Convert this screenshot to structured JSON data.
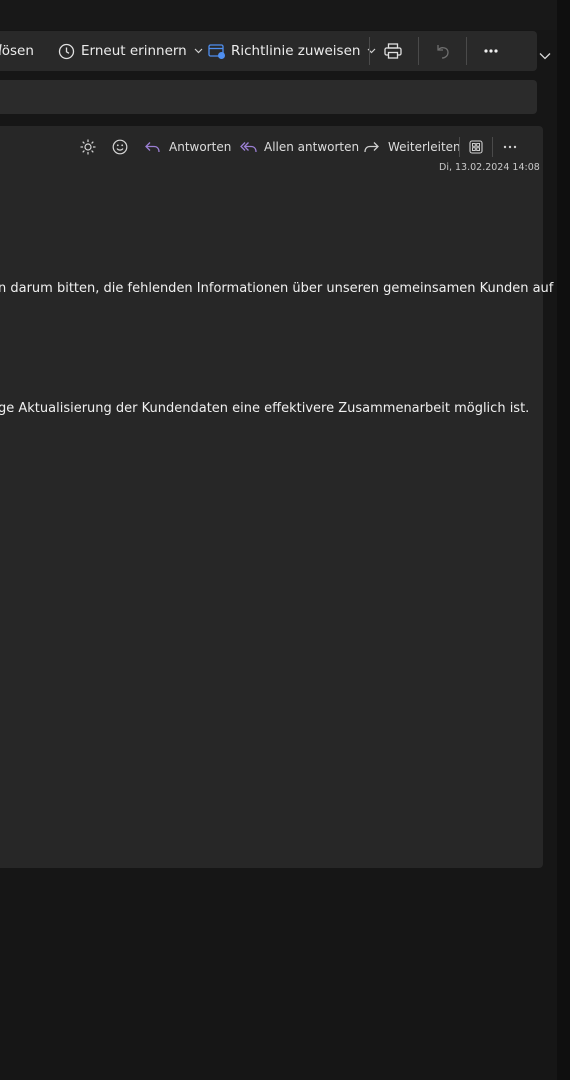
{
  "toolbar": {
    "loesen_label": "lösen",
    "erneut_label": "Erneut erinnern",
    "richtlinie_label": "Richtlinie zuweisen"
  },
  "message": {
    "actions": {
      "reply": "Antworten",
      "reply_all": "Allen antworten",
      "forward": "Weiterleiten"
    },
    "date": "Di, 13.02.2024 14:08",
    "body_line_1": "n darum bitten, die fehlenden Informationen über unseren gemeinsamen Kunden auf",
    "body_line_2": "ge Aktualisierung der Kundendaten eine effektivere Zusammenarbeit möglich ist."
  },
  "colors": {
    "background": "#161616",
    "toolbar": "#292929",
    "pane": "#272727",
    "reply_accent": "#9b7fd4",
    "policy_icon": "#4f8ff0"
  }
}
